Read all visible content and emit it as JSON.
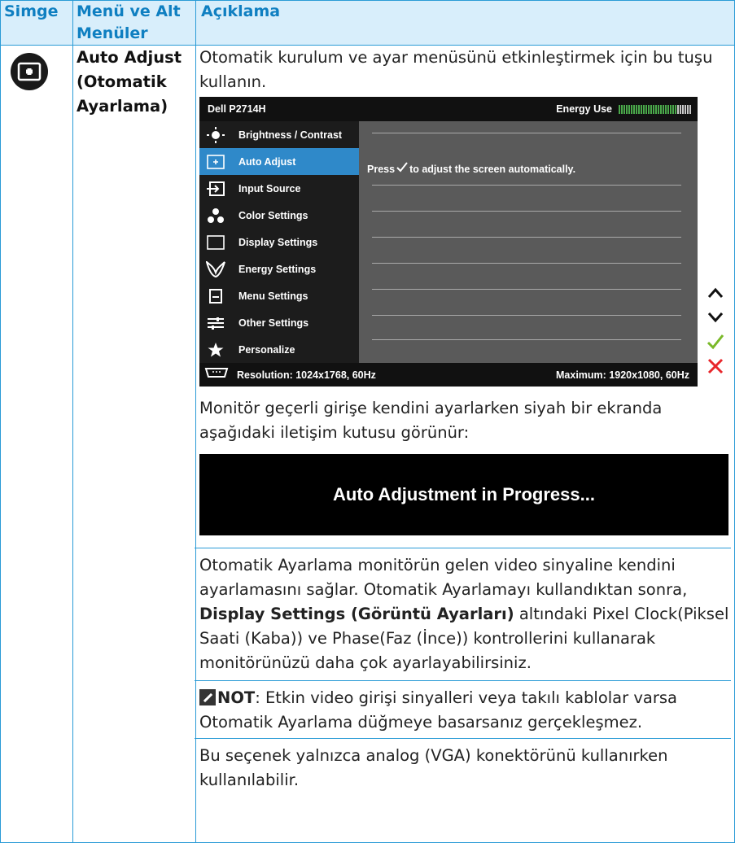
{
  "table": {
    "headers": [
      "Simge",
      "Menü ve Alt Menüler",
      "Açıklama"
    ]
  },
  "row": {
    "icon": "auto-adjust-icon",
    "menu_name": "Auto Adjust (Otomatik Ayarlama)",
    "intro": "Otomatik kurulum ve ayar menüsünü etkinleştirmek için bu tuşu kullanın.",
    "osd": {
      "model": "Dell P2714H",
      "energy_label": "Energy Use",
      "energy_level": 0.8,
      "menu_items": [
        {
          "label": "Brightness / Contrast",
          "icon": "brightness-icon",
          "selected": false
        },
        {
          "label": "Auto Adjust",
          "icon": "auto-adjust-icon",
          "selected": true
        },
        {
          "label": "Input Source",
          "icon": "input-source-icon",
          "selected": false
        },
        {
          "label": "Color Settings",
          "icon": "color-settings-icon",
          "selected": false
        },
        {
          "label": "Display Settings",
          "icon": "display-settings-icon",
          "selected": false
        },
        {
          "label": "Energy Settings",
          "icon": "energy-settings-icon",
          "selected": false
        },
        {
          "label": "Menu Settings",
          "icon": "menu-settings-icon",
          "selected": false
        },
        {
          "label": "Other Settings",
          "icon": "other-settings-icon",
          "selected": false
        },
        {
          "label": "Personalize",
          "icon": "star-icon",
          "selected": false
        }
      ],
      "message_before": "Press",
      "message_after": "to adjust the screen automatically.",
      "resolution": "Resolution: 1024x1768, 60Hz",
      "maximum": "Maximum: 1920x1080, 60Hz",
      "side_buttons": [
        "up-arrow-icon",
        "down-arrow-icon",
        "check-icon",
        "close-icon"
      ],
      "colors": {
        "selected": "#2f89c9",
        "check": "#7ab929",
        "close": "#e8262b",
        "energy": "#4aa84a"
      }
    },
    "dialog_intro": "Monitör geçerli girişe kendini ayarlarken siyah bir ekranda aşağıdaki iletişim kutusu görünür:",
    "dialog_text": "Auto Adjustment in Progress...",
    "para_before": "Otomatik Ayarlama monitörün gelen video sinyaline kendini ayarlamasını sağlar. Otomatik Ayarlamayı kullandıktan sonra, ",
    "para_bold": "Display Settings (Görüntü Ayarları)",
    "para_after": " altındaki Pixel Clock(Piksel Saati (Kaba)) ve Phase(Faz (İnce)) kontrollerini kullanarak monitörünüzü daha çok ayarlayabilirsiniz.",
    "note_label": "NOT",
    "note_text": ": Etkin video girişi sinyalleri veya takılı kablolar varsa Otomatik Ayarlama düğmeye basarsanız gerçekleşmez.",
    "vga_note": "Bu seçenek yalnızca analog (VGA) konektörünü kullanırken kullanılabilir."
  }
}
